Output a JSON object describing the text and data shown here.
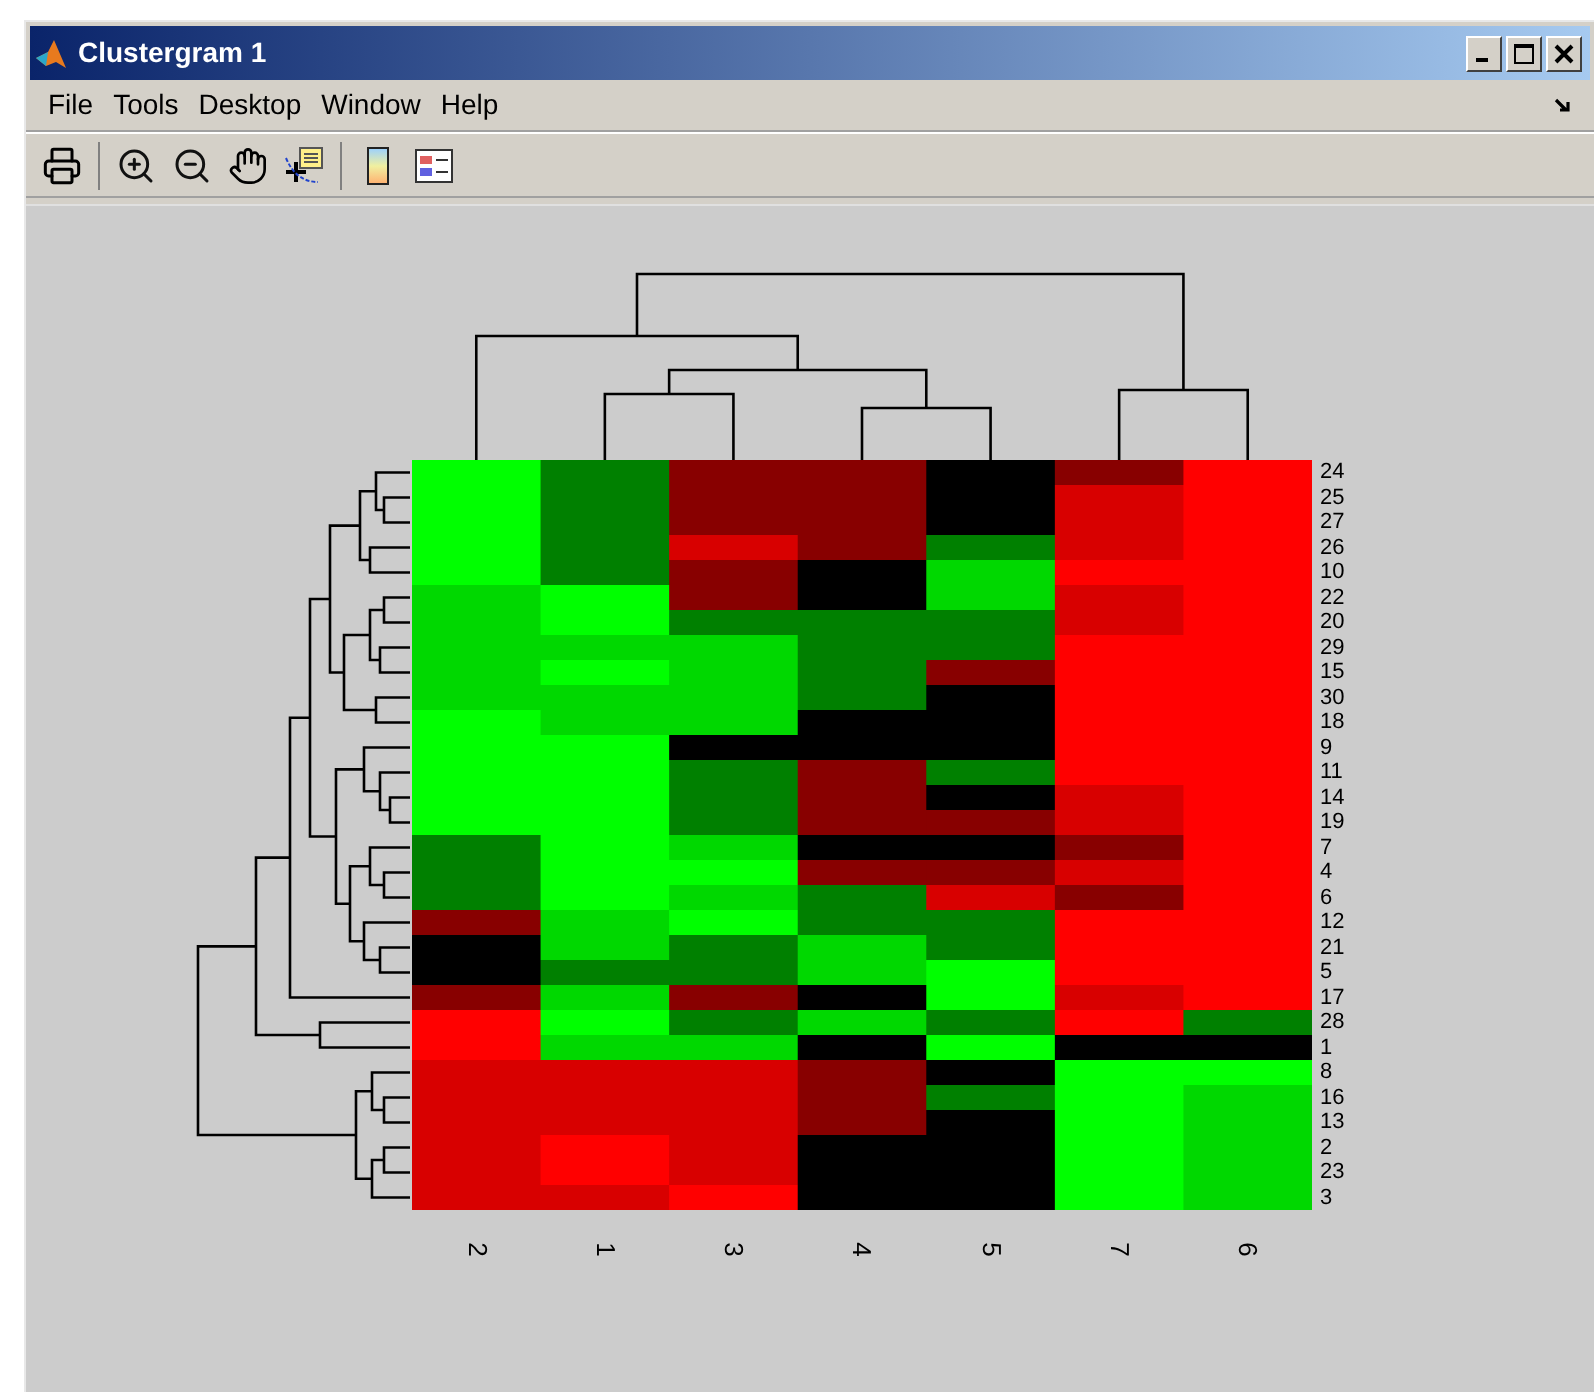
{
  "window": {
    "title": "Clustergram 1"
  },
  "menu": [
    "File",
    "Tools",
    "Desktop",
    "Window",
    "Help"
  ],
  "clustergram": {
    "row_labels": [
      "24",
      "25",
      "27",
      "26",
      "10",
      "22",
      "20",
      "29",
      "15",
      "30",
      "18",
      "9",
      "11",
      "14",
      "19",
      "7",
      "4",
      "6",
      "12",
      "21",
      "5",
      "17",
      "28",
      "1",
      "8",
      "16",
      "13",
      "2",
      "23",
      "3"
    ],
    "column_labels": [
      "2",
      "1",
      "3",
      "4",
      "5",
      "7",
      "6"
    ]
  }
}
